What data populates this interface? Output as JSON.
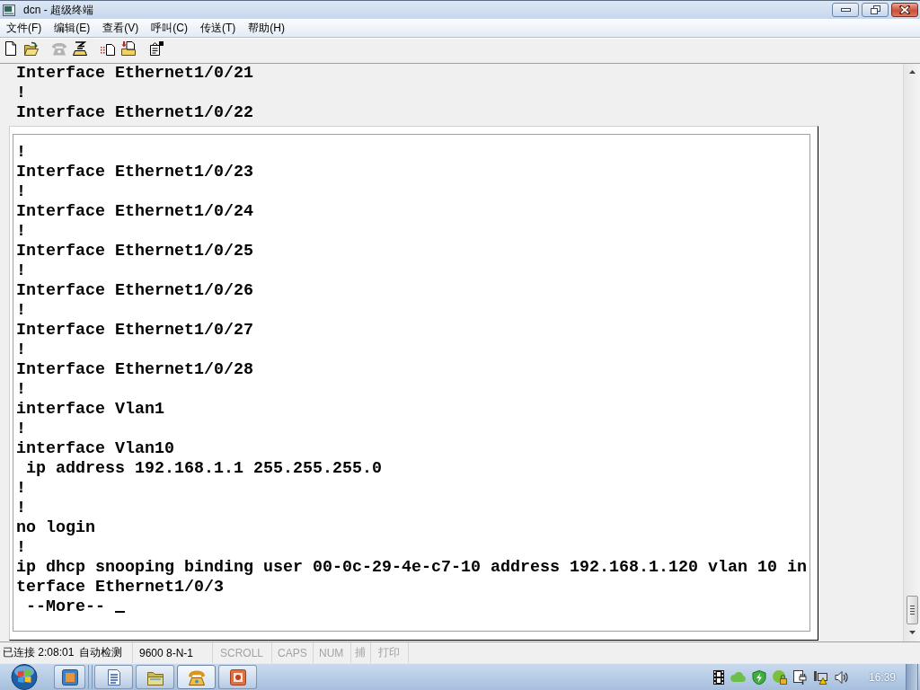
{
  "window": {
    "title": "dcn - 超级终端"
  },
  "menu": [
    "文件(F)",
    "编辑(E)",
    "查看(V)",
    "呼叫(C)",
    "传送(T)",
    "帮助(H)"
  ],
  "toolbar": [
    {
      "kind": "new",
      "disabled": false
    },
    {
      "kind": "open",
      "disabled": false
    },
    {
      "kind": "call",
      "disabled": true
    },
    {
      "kind": "disconnect",
      "disabled": false
    },
    {
      "kind": "send",
      "disabled": false
    },
    {
      "kind": "receive",
      "disabled": false
    },
    {
      "kind": "properties",
      "disabled": false
    }
  ],
  "terminal": {
    "lines": [
      "Interface Ethernet1/0/21",
      "!",
      "Interface Ethernet1/0/22"
    ],
    "panel_lines": [
      "!",
      "Interface Ethernet1/0/23",
      "!",
      "Interface Ethernet1/0/24",
      "!",
      "Interface Ethernet1/0/25",
      "!",
      "Interface Ethernet1/0/26",
      "!",
      "Interface Ethernet1/0/27",
      "!",
      "Interface Ethernet1/0/28",
      "!",
      "interface Vlan1",
      "!",
      "interface Vlan10",
      " ip address 192.168.1.1 255.255.255.0",
      "!",
      "!",
      "no login",
      "!",
      "ip dhcp snooping binding user 00-0c-29-4e-c7-10 address 192.168.1.120 vlan 10 in",
      "terface Ethernet1/0/3"
    ],
    "more_prompt": " --More--"
  },
  "status_bar": [
    {
      "text": "已连接 2:08:01",
      "disabled": false
    },
    {
      "text": "自动检测",
      "disabled": false
    },
    {
      "text": "9600 8-N-1",
      "disabled": false
    },
    {
      "text": "SCROLL",
      "disabled": true
    },
    {
      "text": "CAPS",
      "disabled": true
    },
    {
      "text": "NUM",
      "disabled": true
    },
    {
      "text": "捕",
      "disabled": true
    },
    {
      "text": "打印",
      "disabled": true
    }
  ],
  "taskbar": {
    "buttons": [
      {
        "kind": "window",
        "selected": false
      },
      {
        "kind": "document",
        "selected": false
      },
      {
        "kind": "folder",
        "selected": false
      },
      {
        "kind": "phone",
        "selected": true
      },
      {
        "kind": "slide",
        "selected": false
      }
    ],
    "clock": "16:39"
  }
}
